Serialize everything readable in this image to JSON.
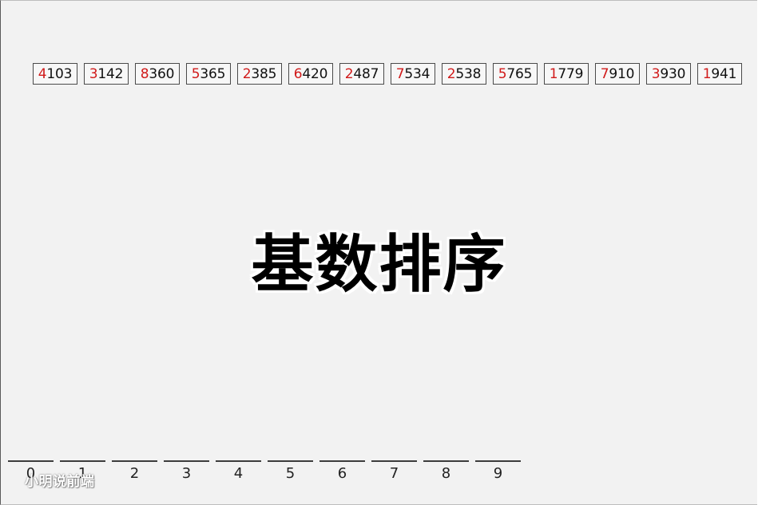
{
  "numbers": [
    {
      "lead": "4",
      "rest": "103"
    },
    {
      "lead": "3",
      "rest": "142"
    },
    {
      "lead": "8",
      "rest": "360"
    },
    {
      "lead": "5",
      "rest": "365"
    },
    {
      "lead": "2",
      "rest": "385"
    },
    {
      "lead": "6",
      "rest": "420"
    },
    {
      "lead": "2",
      "rest": "487"
    },
    {
      "lead": "7",
      "rest": "534"
    },
    {
      "lead": "2",
      "rest": "538"
    },
    {
      "lead": "5",
      "rest": "765"
    },
    {
      "lead": "1",
      "rest": "779"
    },
    {
      "lead": "7",
      "rest": "910"
    },
    {
      "lead": "3",
      "rest": "930"
    },
    {
      "lead": "1",
      "rest": "941"
    }
  ],
  "title": "基数排序",
  "buckets": [
    "0",
    "1",
    "2",
    "3",
    "4",
    "5",
    "6",
    "7",
    "8",
    "9"
  ],
  "watermark": "小明说前端",
  "colors": {
    "background": "#f2f2f2",
    "highlight_digit": "#d11a1a",
    "text": "#111111"
  }
}
